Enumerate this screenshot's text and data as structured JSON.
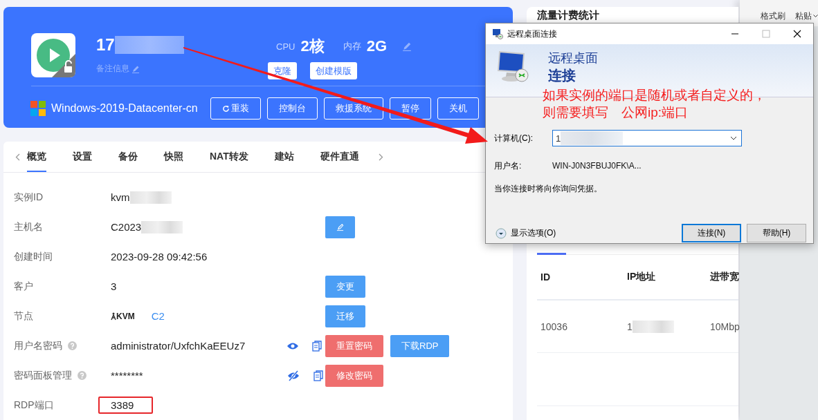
{
  "instance": {
    "name": "17",
    "name_redacted": true,
    "remark": "备注信息",
    "cpu_label": "CPU",
    "cpu": "2核",
    "mem_label": "内存",
    "mem": "2G",
    "top_actions": [
      "克隆",
      "创建模版"
    ],
    "os": "Windows-2019-Datacenter-cn",
    "actions": [
      {
        "label": "重装",
        "kind": "reinstall"
      },
      {
        "label": "控制台",
        "kind": "plain"
      },
      {
        "label": "救援系统",
        "kind": "plain"
      },
      {
        "label": "暂停",
        "kind": "plain"
      },
      {
        "label": "关机",
        "kind": "plain"
      }
    ]
  },
  "tabs": [
    {
      "label": "概览",
      "selected": true
    },
    {
      "label": "设置",
      "selected": false
    },
    {
      "label": "备份",
      "selected": false
    },
    {
      "label": "快照",
      "selected": false
    },
    {
      "label": "NAT转发",
      "selected": false
    },
    {
      "label": "建站",
      "selected": false
    },
    {
      "label": "硬件直通",
      "selected": false
    }
  ],
  "details": [
    {
      "label": "实例ID",
      "value": "kvm",
      "redacted": true
    },
    {
      "label": "主机名",
      "value": "C2023",
      "redacted": true,
      "buttons": [
        {
          "kind": "edit-icon"
        }
      ]
    },
    {
      "label": "创建时间",
      "value": "2023-09-28 09:42:56"
    },
    {
      "label": "客户",
      "value": "3",
      "buttons": [
        {
          "kind": "primary",
          "label": "变更"
        }
      ]
    },
    {
      "label": "节点",
      "value": "KVM",
      "node": true,
      "link": "C2",
      "buttons": [
        {
          "kind": "primary",
          "label": "迁移"
        }
      ]
    },
    {
      "label": "用户名密码",
      "help": true,
      "value": "administrator/UxfchKaEEUz7",
      "revealed": true,
      "buttons": [
        {
          "kind": "danger",
          "label": "重置密码"
        },
        {
          "kind": "primary",
          "label": "下载RDP"
        }
      ]
    },
    {
      "label": "密码面板管理",
      "help": true,
      "value": "********",
      "revealed": false,
      "buttons": [
        {
          "kind": "danger",
          "label": "修改密码"
        }
      ]
    },
    {
      "label": "RDP端口",
      "value": "3389",
      "highlighted": true
    }
  ],
  "traffic": {
    "title": "流量计费统计",
    "columns": [
      "ID",
      "IP地址",
      "进带宽"
    ],
    "rows": [
      {
        "cells": [
          {
            "text": "10036"
          },
          {
            "text": "1",
            "redacted": true
          },
          {
            "text": "10Mbp"
          }
        ]
      }
    ]
  },
  "ribbon": {
    "items": [
      {
        "label": "格式刷"
      },
      {
        "label": "粘贴",
        "caret": true
      }
    ]
  },
  "dialog": {
    "title": "远程桌面连接",
    "heading1": "远程桌面",
    "heading2": "连接",
    "computer_label": "计算机(C):",
    "computer_value": "1",
    "computer_redacted": true,
    "user_label": "用户名:",
    "user_value": "WIN-J0N3FBUJ0FK\\A...",
    "note": "当你连接时将向你询问凭据。",
    "options": "显示选项(O)",
    "buttons": [
      {
        "label": "连接(N)",
        "default": true
      },
      {
        "label": "帮助(H)",
        "default": false
      }
    ]
  },
  "annotation": {
    "lines": [
      "如果实例的端口是随机或者自定义的，",
      "则需要填写　公网ip:端口"
    ]
  }
}
